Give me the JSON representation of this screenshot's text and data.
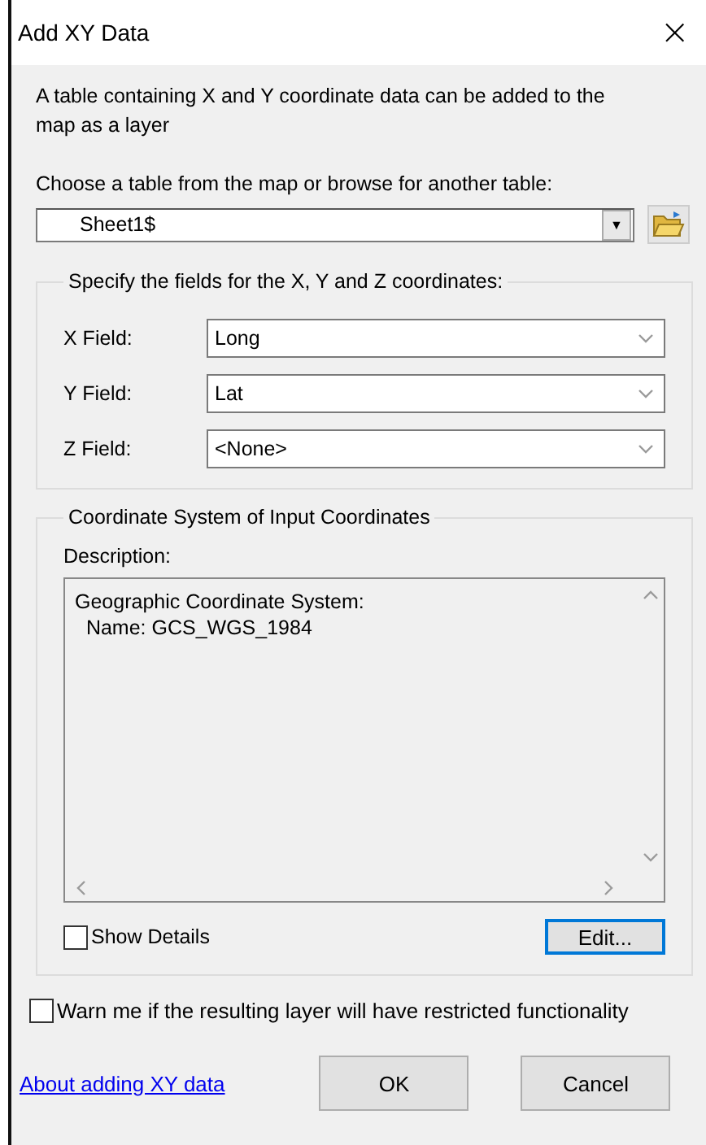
{
  "window": {
    "title": "Add XY Data",
    "close": "×"
  },
  "intro": "A table containing X and Y coordinate data can be added to the map as a layer",
  "table_prompt": "Choose a table from the map or browse for another table:",
  "table_select": {
    "value": "Sheet1$",
    "arrow": "▼"
  },
  "fields_group": {
    "title": "Specify the fields for the X, Y and Z coordinates:",
    "fields": [
      {
        "label": "X Field:",
        "value": "Long"
      },
      {
        "label": "Y Field:",
        "value": "Lat"
      },
      {
        "label": "Z Field:",
        "value": "<None>"
      }
    ]
  },
  "coord_group": {
    "title": "Coordinate System of Input Coordinates",
    "description_label": "Description:",
    "description_lines": [
      "Geographic Coordinate System:",
      "  Name: GCS_WGS_1984"
    ],
    "show_details": {
      "label": "Show Details",
      "checked": false
    },
    "edit_button": "Edit..."
  },
  "warn": {
    "label": "Warn me if the resulting layer will have restricted functionality",
    "checked": false
  },
  "help_link": "About adding XY data",
  "buttons": [
    "OK",
    "Cancel"
  ]
}
